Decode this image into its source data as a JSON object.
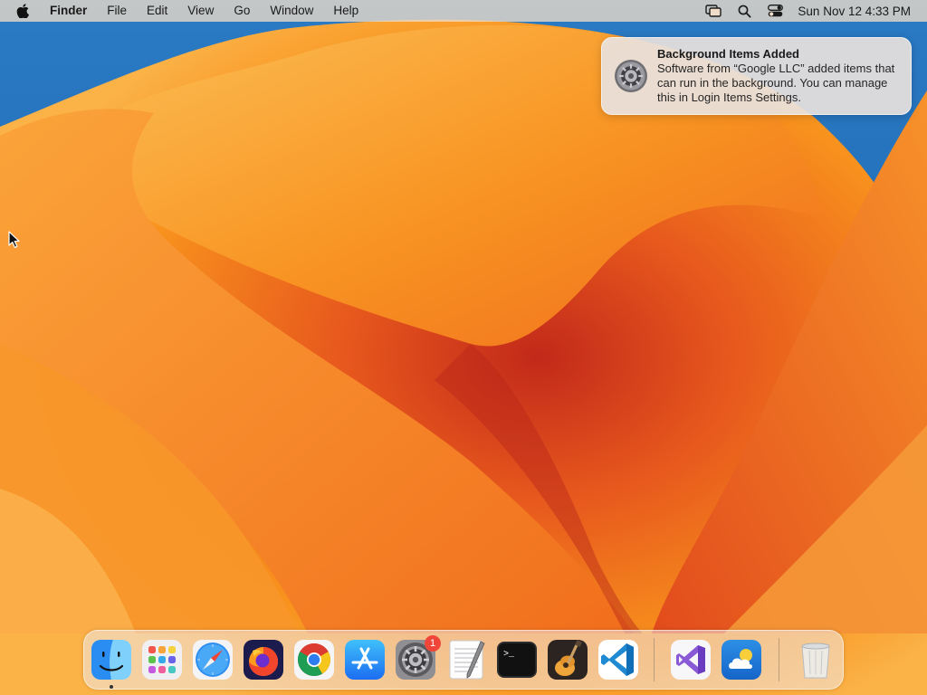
{
  "menubar": {
    "app_name": "Finder",
    "menus": [
      "File",
      "Edit",
      "View",
      "Go",
      "Window",
      "Help"
    ],
    "clock": "Sun Nov 12  4:33 PM",
    "status_icons": [
      "screen-mirroring-icon",
      "spotlight-search-icon",
      "control-center-icon"
    ]
  },
  "notification": {
    "title": "Background Items Added",
    "body": "Software from “Google LLC” added items that can run in the background. You can manage this in Login Items Settings.",
    "icon": "system-settings-gear-icon"
  },
  "dock": {
    "apps": [
      {
        "name": "Finder",
        "icon": "finder-icon",
        "running": true
      },
      {
        "name": "Launchpad",
        "icon": "launchpad-icon",
        "running": false
      },
      {
        "name": "Safari",
        "icon": "safari-icon",
        "running": false
      },
      {
        "name": "Firefox",
        "icon": "firefox-icon",
        "running": false
      },
      {
        "name": "Google Chrome",
        "icon": "chrome-icon",
        "running": false
      },
      {
        "name": "App Store",
        "icon": "app-store-icon",
        "running": false
      },
      {
        "name": "System Settings",
        "icon": "system-settings-icon",
        "running": false,
        "badge": "1"
      },
      {
        "name": "TextEdit",
        "icon": "textedit-icon",
        "running": false
      },
      {
        "name": "Terminal",
        "icon": "terminal-icon",
        "running": false
      },
      {
        "name": "GarageBand",
        "icon": "garageband-icon",
        "running": false
      },
      {
        "name": "Visual Studio Code",
        "icon": "vscode-icon",
        "running": false
      }
    ],
    "recent_apps": [
      {
        "name": "Visual Studio",
        "icon": "visual-studio-icon"
      },
      {
        "name": "Weather",
        "icon": "weather-icon"
      }
    ],
    "trash": {
      "name": "Trash",
      "icon": "trash-icon"
    }
  },
  "colors": {
    "wallpaper_blue": "#1f6fbd",
    "wallpaper_orange": "#f7931e",
    "badge_red": "#f0463a"
  }
}
